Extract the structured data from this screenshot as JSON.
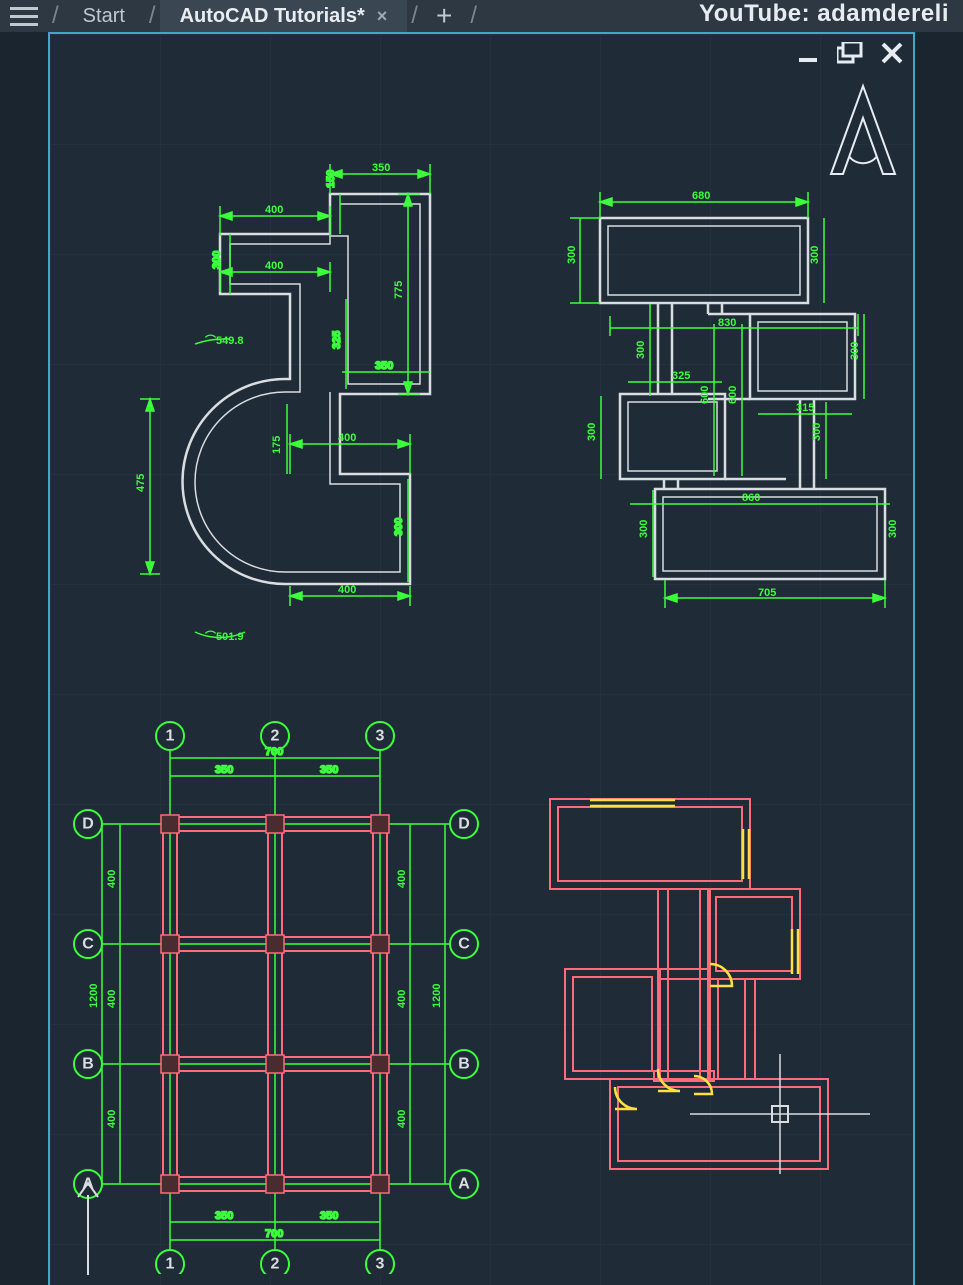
{
  "tabs": {
    "start": "Start",
    "active": "AutoCAD Tutorials*",
    "close": "×",
    "add": "+"
  },
  "branding": "YouTube: adamdereli",
  "top_left_drawing": {
    "dims": {
      "d350a": "350",
      "d150": "150",
      "d400a": "400",
      "d300": "300",
      "d400b": "400",
      "d775": "775",
      "d325": "325",
      "d350b": "350",
      "d549_8": "⌒549.8",
      "d175": "175",
      "d400c": "400",
      "d300b": "300",
      "d400d": "400",
      "d475": "475",
      "d501_9": "⌒501.9"
    }
  },
  "top_right_drawing": {
    "dims": {
      "d680": "680",
      "d300a": "300",
      "d300b": "300",
      "d830": "830",
      "d300c": "300",
      "d300d": "300",
      "d325": "325",
      "d600a": "600",
      "d600b": "600",
      "d315": "315",
      "d300e": "300",
      "d300f": "300",
      "d860": "860",
      "d300g": "300",
      "d705": "705"
    }
  },
  "bottom_left_grid": {
    "cols": {
      "c1": "1",
      "c2": "2",
      "c3": "3"
    },
    "rows": {
      "rA": "A",
      "rB": "B",
      "rC": "C",
      "rD": "D"
    },
    "dims": {
      "d700a": "700",
      "d350a": "350",
      "d350b": "350",
      "d400a": "400",
      "d400b": "400",
      "d400c": "400",
      "d400d": "400",
      "d400e": "400",
      "d400f": "400",
      "d1200a": "1200",
      "d1200b": "1200",
      "d700b": "700",
      "d350c": "350",
      "d350d": "350"
    }
  },
  "colors": {
    "dim": "#3bff3b",
    "outline": "#d9dde1",
    "pink": "#ff6b7a",
    "yellow": "#ffe040"
  }
}
